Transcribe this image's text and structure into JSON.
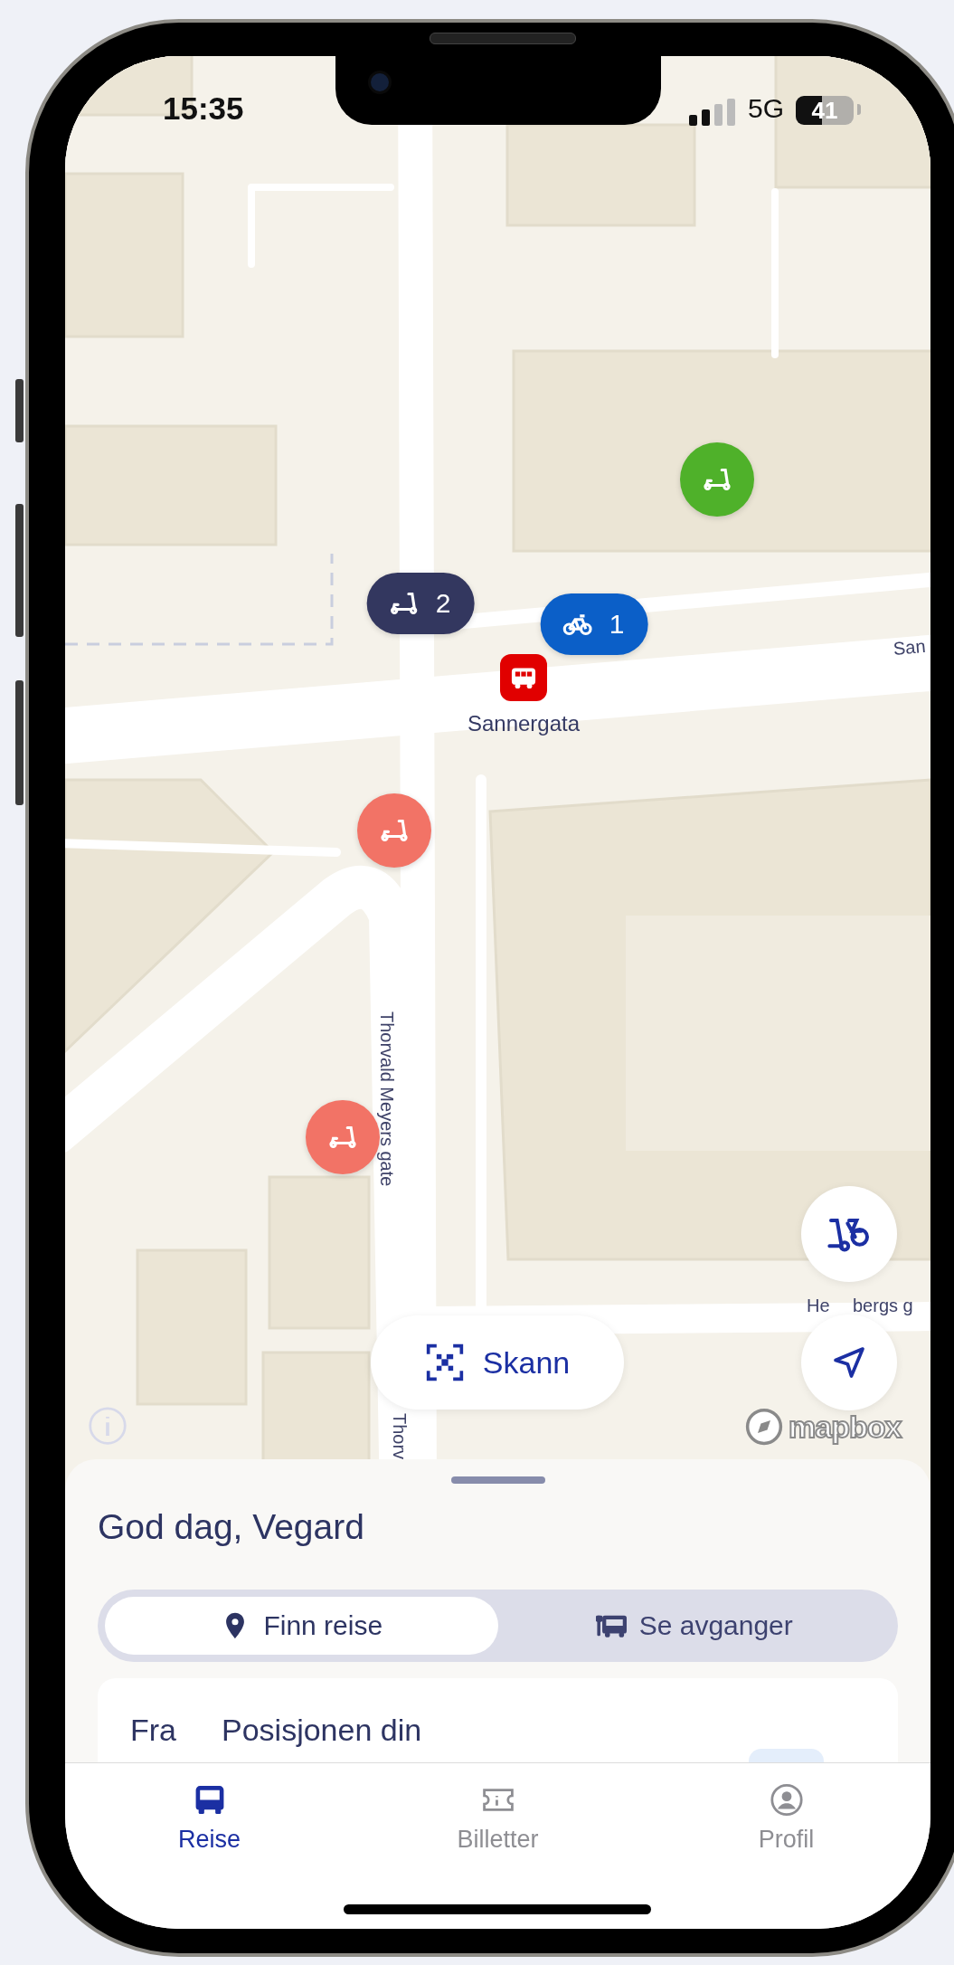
{
  "status_bar": {
    "time": "15:35",
    "network": "5G",
    "battery": "41"
  },
  "map": {
    "markers": [
      {
        "kind": "scooter",
        "color": "#4fb12a"
      },
      {
        "kind": "scooter",
        "color": "#33375f",
        "count": "2"
      },
      {
        "kind": "bike",
        "color": "#0b5fc8",
        "count": "1"
      },
      {
        "kind": "bus",
        "color": "#e10000"
      },
      {
        "kind": "scooter",
        "color": "#f27366"
      },
      {
        "kind": "scooter",
        "color": "#f27366"
      }
    ],
    "stop_label": "Sannergata",
    "street_labels": [
      "San",
      "Thorvald Meyers gate",
      "Thorv",
      "He",
      "bergs g"
    ],
    "scan_button": {
      "label": "Skann"
    },
    "attribution": "mapbox"
  },
  "sheet": {
    "greeting": "God dag, Vegard",
    "modes": [
      {
        "label": "Finn reise",
        "selected": true
      },
      {
        "label": "Se avganger",
        "selected": false
      }
    ],
    "from": {
      "label": "Fra",
      "value": "Posisjonen din"
    }
  },
  "tab_bar": [
    {
      "label": "Reise",
      "selected": true
    },
    {
      "label": "Billetter",
      "selected": false
    },
    {
      "label": "Profil",
      "selected": false
    }
  ]
}
